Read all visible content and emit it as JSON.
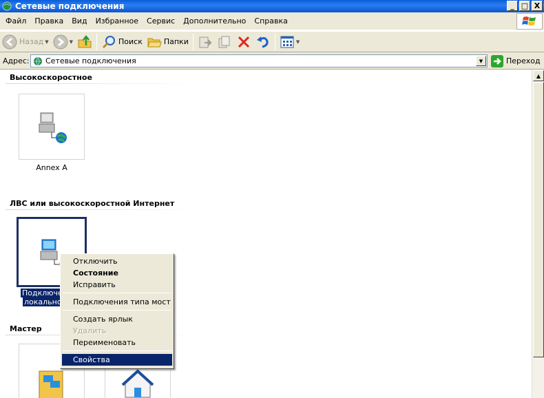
{
  "window": {
    "title": "Сетевые подключения",
    "minimize": "_",
    "maximize": "□",
    "close": "X"
  },
  "menu": [
    "Файл",
    "Правка",
    "Вид",
    "Избранное",
    "Сервис",
    "Дополнительно",
    "Справка"
  ],
  "toolbar": {
    "back": "Назад",
    "search": "Поиск",
    "folders": "Папки"
  },
  "address": {
    "label": "Адрес:",
    "value": "Сетевые подключения",
    "go": "Переход"
  },
  "groups": {
    "highspeed": {
      "header": "Высокоскоростное",
      "items": [
        {
          "label": "Annex A"
        }
      ]
    },
    "lan": {
      "header": "ЛВС или высокоскоростной Интернет",
      "items": [
        {
          "label_line1": "Подключе",
          "label_line2": "локальной"
        }
      ]
    },
    "wizard": {
      "header": "Мастер"
    }
  },
  "context_menu": {
    "items": [
      {
        "label": "Отключить"
      },
      {
        "label": "Состояние"
      },
      {
        "label": "Исправить"
      },
      {
        "label": "Подключения типа мост"
      },
      {
        "label": "Создать ярлык"
      },
      {
        "label": "Удалить"
      },
      {
        "label": "Переименовать"
      },
      {
        "label": "Свойства"
      }
    ]
  }
}
